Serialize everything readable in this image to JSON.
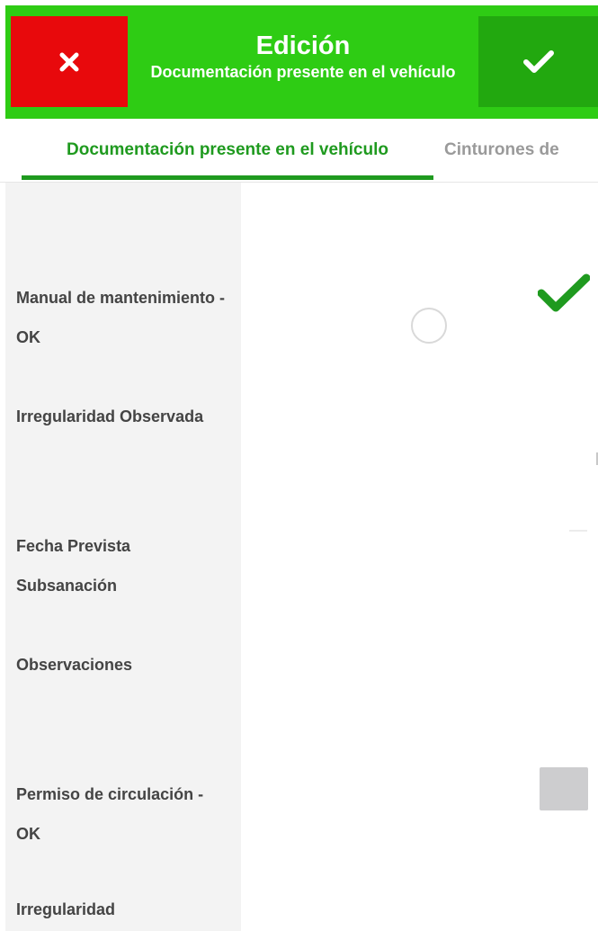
{
  "header": {
    "title": "Edición",
    "subtitle": "Documentación presente en el vehículo",
    "background_color": "#2ecc14",
    "cancel_color": "#e8090c",
    "confirm_color": "#22a80f",
    "cancel_icon": "close-icon",
    "confirm_icon": "checkmark-icon"
  },
  "tabs": [
    {
      "label": "Documentación presente en el vehículo",
      "active": true
    },
    {
      "label": "Cinturones de",
      "active": false
    }
  ],
  "form": {
    "fields": [
      {
        "label": "Manual de mantenimiento - OK",
        "type": "checkbox",
        "checked": true
      },
      {
        "label": "Irregularidad Observada",
        "type": "radio",
        "selected": false
      },
      {
        "label": "Fecha Prevista Subsanación",
        "type": "date",
        "value": ""
      },
      {
        "label": "Observaciones",
        "type": "text",
        "value": ""
      },
      {
        "label": "Permiso de circulación - OK",
        "type": "checkbox",
        "checked": false
      },
      {
        "label": "Irregularidad",
        "type": "radio",
        "selected": false
      }
    ],
    "accent_color": "#1f9a1f",
    "check_icon": "checkmark-icon"
  }
}
